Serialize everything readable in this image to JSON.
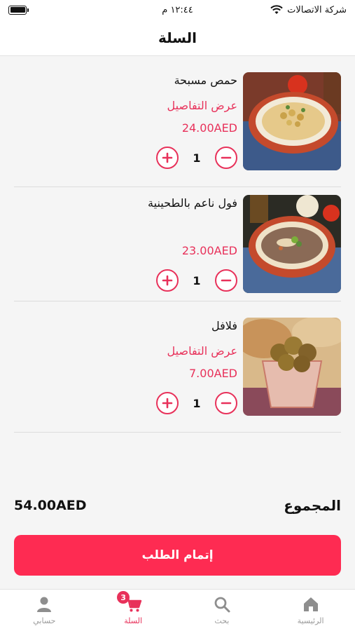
{
  "status_bar": {
    "carrier": "شركة الاتصالات",
    "time": "١٢:٤٤ م"
  },
  "header": {
    "title": "السلة"
  },
  "cart": {
    "items": [
      {
        "name": "حمص مسبحة",
        "details_label": "عرض التفاصيل",
        "price": "24.00AED",
        "quantity": "1",
        "image": "hummus-photo"
      },
      {
        "name": "فول ناعم بالطحينية",
        "details_label": "",
        "price": "23.00AED",
        "quantity": "1",
        "image": "foul-photo"
      },
      {
        "name": "فلافل",
        "details_label": "عرض التفاصيل",
        "price": "7.00AED",
        "quantity": "1",
        "image": "falafel-photo"
      }
    ]
  },
  "summary": {
    "total_label": "المجموع",
    "total_value": "54.00AED"
  },
  "checkout": {
    "label": "إتمام الطلب"
  },
  "bottom_nav": {
    "items": [
      {
        "label": "الرئيسية",
        "icon": "home-icon"
      },
      {
        "label": "بحث",
        "icon": "search-icon"
      },
      {
        "label": "السلة",
        "icon": "cart-icon",
        "badge": "3"
      },
      {
        "label": "حسابي",
        "icon": "user-icon"
      }
    ]
  },
  "colors": {
    "accent": "#e8315a",
    "button": "#fe2b52",
    "background": "#f5f5f5"
  }
}
